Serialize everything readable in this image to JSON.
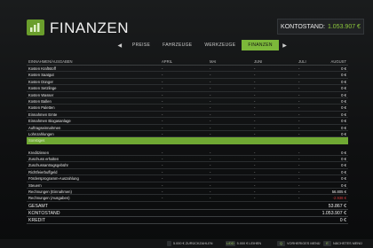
{
  "header": {
    "title": "FINANZEN",
    "balance_label": "KONTOSTAND:",
    "balance_value": "1.053.907 €"
  },
  "tabs": [
    {
      "label": "PREISE",
      "active": false
    },
    {
      "label": "FAHRZEUGE",
      "active": false
    },
    {
      "label": "WERKZEUGE",
      "active": false
    },
    {
      "label": "FINANZEN",
      "active": true
    }
  ],
  "table": {
    "columns": [
      "EINNAHMEN/AUSGABEN",
      "APRIL",
      "MAI",
      "JUNI",
      "JULI",
      "AUGUST"
    ],
    "rows": [
      {
        "label": "Kosten Kraftstoff",
        "values": [
          "-",
          "-",
          "-",
          "-",
          "0 €"
        ]
      },
      {
        "label": "Kosten Saatgut",
        "values": [
          "-",
          "-",
          "-",
          "-",
          "0 €"
        ]
      },
      {
        "label": "Kosten Dünger",
        "values": [
          "-",
          "-",
          "-",
          "-",
          "0 €"
        ]
      },
      {
        "label": "Kosten Setzlinge",
        "values": [
          "-",
          "-",
          "-",
          "-",
          "0 €"
        ]
      },
      {
        "label": "Kosten Wasser",
        "values": [
          "-",
          "-",
          "-",
          "-",
          "0 €"
        ]
      },
      {
        "label": "Kosten Ballen",
        "values": [
          "-",
          "-",
          "-",
          "-",
          "0 €"
        ]
      },
      {
        "label": "Kosten Paletten",
        "values": [
          "-",
          "-",
          "-",
          "-",
          "0 €"
        ]
      },
      {
        "label": "Einnahmen Ernte",
        "values": [
          "-",
          "-",
          "-",
          "-",
          "0 €"
        ]
      },
      {
        "label": "Einnahmen Biogasanlage",
        "values": [
          "-",
          "-",
          "-",
          "-",
          "0 €"
        ]
      },
      {
        "label": "Auftragseinnahmen",
        "values": [
          "-",
          "-",
          "-",
          "-",
          "0 €"
        ]
      },
      {
        "label": "Lohnzahlungen",
        "values": [
          "-",
          "-",
          "-",
          "-",
          "0 €"
        ]
      },
      {
        "label": "Sonstiges",
        "values": [
          "",
          "",
          "",
          "",
          ""
        ],
        "highlight": true
      }
    ],
    "rows2": [
      {
        "label": "Kreditzinsen",
        "values": [
          "-",
          "-",
          "-",
          "-",
          "0 €"
        ]
      },
      {
        "label": "Zuschuss erhalten",
        "values": [
          "-",
          "-",
          "-",
          "-",
          "0 €"
        ]
      },
      {
        "label": "Zuschussantragsgebühr",
        "values": [
          "-",
          "-",
          "-",
          "-",
          "0 €"
        ]
      },
      {
        "label": "Richtfeierbuffgeld",
        "values": [
          "-",
          "-",
          "-",
          "-",
          "0 €"
        ]
      },
      {
        "label": "Fördersprogramm-Auszahlung",
        "values": [
          "-",
          "-",
          "-",
          "-",
          "0 €"
        ]
      },
      {
        "label": "Steuern",
        "values": [
          "-",
          "-",
          "-",
          "-",
          "0 €"
        ]
      },
      {
        "label": "Rechnungen (Einnahmen)",
        "values": [
          "-",
          "-",
          "-",
          "-",
          "56.805 €"
        ]
      },
      {
        "label": "Rechnungen (Ausgaben)",
        "values": [
          "-",
          "-",
          "-",
          "-",
          "-2.938 €"
        ],
        "negative_last": true
      }
    ]
  },
  "totals": [
    {
      "label": "GESAMT",
      "value": "53.867 €"
    },
    {
      "label": "KONTOSTAND",
      "value": "1.053.907 €"
    },
    {
      "label": "KREDIT",
      "value": "0 €"
    }
  ],
  "footer": [
    {
      "key": "",
      "label": "5.000 € ZURÜCKZAHLEN"
    },
    {
      "key": "L/DD",
      "label": "5.000 € LEIHEN"
    },
    {
      "key": "Q",
      "label": "VORHERIGES MENÜ"
    },
    {
      "key": "E",
      "label": "NÄCHSTES MENÜ"
    }
  ],
  "colors": {
    "accent": "#7cb83a",
    "negative": "#d33c3c",
    "balance_value": "#8cc83c"
  }
}
